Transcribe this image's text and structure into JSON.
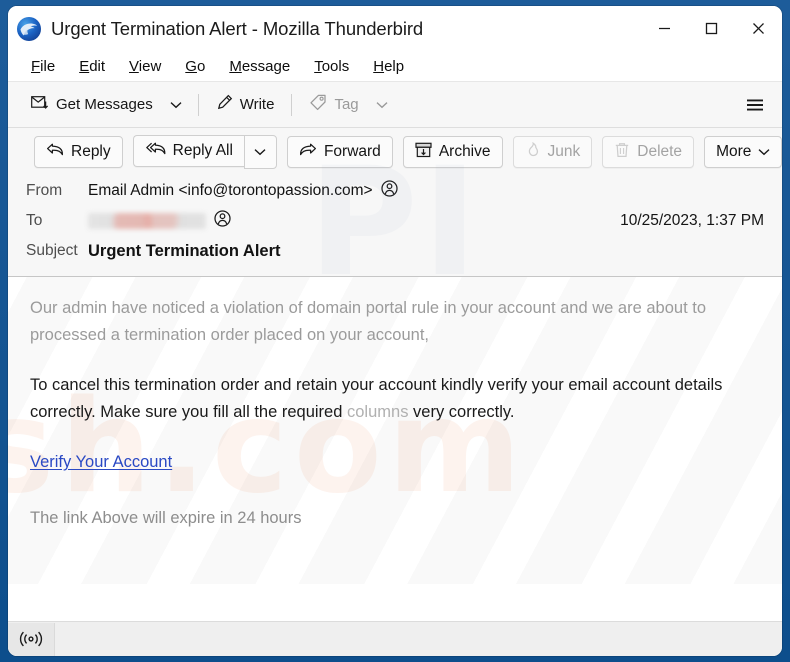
{
  "window": {
    "title": "Urgent Termination Alert - Mozilla Thunderbird",
    "app_icon": "thunderbird-logo-icon",
    "controls": {
      "minimize": "minimize-icon",
      "maximize": "maximize-icon",
      "close": "close-icon"
    },
    "frame_color": "#1c5c99"
  },
  "menubar": {
    "items": [
      {
        "accesskey": "F",
        "rest": "ile"
      },
      {
        "accesskey": "E",
        "rest": "dit"
      },
      {
        "accesskey": "V",
        "rest": "iew"
      },
      {
        "accesskey": "G",
        "rest": "o"
      },
      {
        "accesskey": "M",
        "rest": "essage"
      },
      {
        "accesskey": "T",
        "rest": "ools"
      },
      {
        "accesskey": "H",
        "rest": "elp"
      }
    ]
  },
  "toolbar": {
    "get_messages": "Get Messages",
    "write": "Write",
    "tag": "Tag",
    "hamburger": "app-menu-icon"
  },
  "message_actions": {
    "reply": "Reply",
    "reply_all": "Reply All",
    "forward": "Forward",
    "archive": "Archive",
    "junk": "Junk",
    "delete": "Delete",
    "more": "More"
  },
  "headers": {
    "from_label": "From",
    "from_value": "Email Admin <info@torontopassion.com>",
    "to_label": "To",
    "to_value": "",
    "subject_label": "Subject",
    "subject_value": "Urgent Termination Alert",
    "date": "10/25/2023, 1:37 PM"
  },
  "body": {
    "paragraph1": "Our admin have noticed a violation of domain portal  rule in your  account  and we are about to processed a termination order placed  on your account,",
    "paragraph2_a": "To cancel this termination order and retain your account kindly verify your email account details correctly. Make sure you fill all the required ",
    "paragraph2_faded": "columns",
    "paragraph2_b": " very correctly.",
    "link_text": "Verify Your Account",
    "paragraph3": "The link Above will expire in 24 hours",
    "link_color": "#2a49c4",
    "watermark_orange": "sh.com",
    "watermark_gray": "PI"
  },
  "statusbar": {
    "icon": "broadcast-icon",
    "text": ""
  }
}
